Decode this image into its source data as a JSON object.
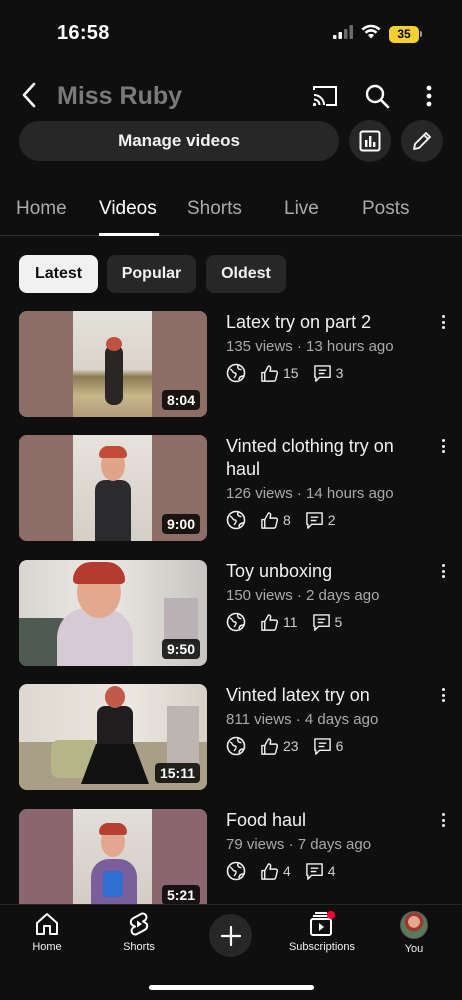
{
  "status": {
    "time": "16:58",
    "battery": "35"
  },
  "header": {
    "title": "Miss Ruby",
    "icons": [
      "back-icon",
      "cast-icon",
      "search-icon",
      "more-vert-icon"
    ]
  },
  "actions": {
    "manage_label": "Manage videos",
    "icons": [
      "analytics-icon",
      "edit-icon"
    ]
  },
  "tabs": [
    {
      "label": "Home",
      "active": false
    },
    {
      "label": "Videos",
      "active": true
    },
    {
      "label": "Shorts",
      "active": false
    },
    {
      "label": "Live",
      "active": false
    },
    {
      "label": "Posts",
      "active": false
    }
  ],
  "filters": [
    {
      "label": "Latest",
      "active": true
    },
    {
      "label": "Popular",
      "active": false
    },
    {
      "label": "Oldest",
      "active": false
    }
  ],
  "videos": [
    {
      "title": "Latex try on part 2",
      "meta": "135 views · 13 hours ago",
      "likes": "15",
      "comments": "3",
      "duration": "8:04"
    },
    {
      "title": "Vinted clothing try on haul",
      "meta": "126 views · 14 hours ago",
      "likes": "8",
      "comments": "2",
      "duration": "9:00"
    },
    {
      "title": "Toy unboxing",
      "meta": "150 views · 2 days ago",
      "likes": "11",
      "comments": "5",
      "duration": "9:50"
    },
    {
      "title": "Vinted latex try on",
      "meta": "811 views · 4 days ago",
      "likes": "23",
      "comments": "6",
      "duration": "15:11"
    },
    {
      "title": "Food haul",
      "meta": "79 views · 7 days ago",
      "likes": "4",
      "comments": "4",
      "duration": "5:21"
    }
  ],
  "bottom_nav": [
    {
      "label": "Home",
      "icon": "home-icon"
    },
    {
      "label": "Shorts",
      "icon": "shorts-icon"
    },
    {
      "label": "",
      "icon": "create-icon"
    },
    {
      "label": "Subscriptions",
      "icon": "subscriptions-icon"
    },
    {
      "label": "You",
      "icon": "avatar"
    }
  ],
  "colors": {
    "background": "#0f0f0f",
    "chip": "#272727",
    "muted_text": "#aaaaaa",
    "notification_dot": "#ff0033",
    "battery": "#f5d130"
  }
}
